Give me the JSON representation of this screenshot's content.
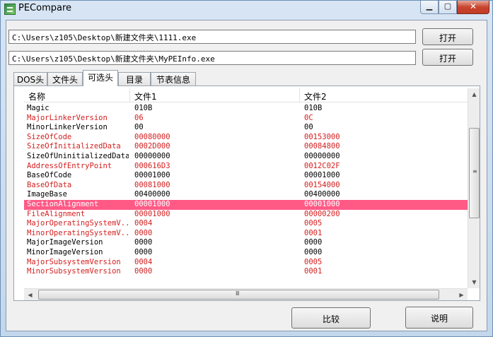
{
  "window": {
    "title": "PECompare"
  },
  "files": [
    {
      "path": "C:\\Users\\z105\\Desktop\\新建文件夹\\1111.exe",
      "open_label": "打开"
    },
    {
      "path": "C:\\Users\\z105\\Desktop\\新建文件夹\\MyPEInfo.exe",
      "open_label": "打开"
    }
  ],
  "tabs": [
    {
      "label": "DOS头"
    },
    {
      "label": "文件头"
    },
    {
      "label": "可选头",
      "active": true
    },
    {
      "label": "目录"
    },
    {
      "label": "节表信息"
    }
  ],
  "table": {
    "columns": [
      "名称",
      "文件1",
      "文件2"
    ],
    "rows": [
      {
        "name": "Magic",
        "file1": "010B",
        "file2": "010B",
        "status": "same"
      },
      {
        "name": "MajorLinkerVersion",
        "file1": "06",
        "file2": "0C",
        "status": "diff"
      },
      {
        "name": "MinorLinkerVersion",
        "file1": "00",
        "file2": "00",
        "status": "same"
      },
      {
        "name": "SizeOfCode",
        "file1": "00080000",
        "file2": "00153000",
        "status": "diff"
      },
      {
        "name": "SizeOfInitializedData",
        "file1": "0002D000",
        "file2": "00084800",
        "status": "diff"
      },
      {
        "name": "SizeOfUninitializedData",
        "file1": "00000000",
        "file2": "00000000",
        "status": "same"
      },
      {
        "name": "AddressOfEntryPoint",
        "file1": "000616D3",
        "file2": "0012C02F",
        "status": "diff"
      },
      {
        "name": "BaseOfCode",
        "file1": "00001000",
        "file2": "00001000",
        "status": "same"
      },
      {
        "name": "BaseOfData",
        "file1": "00081000",
        "file2": "00154000",
        "status": "diff"
      },
      {
        "name": "ImageBase",
        "file1": "00400000",
        "file2": "00400000",
        "status": "same"
      },
      {
        "name": "SectionAlignment",
        "file1": "00001000",
        "file2": "00001000",
        "status": "selected"
      },
      {
        "name": "FileAlignment",
        "file1": "00001000",
        "file2": "00000200",
        "status": "diff"
      },
      {
        "name": "MajorOperatingSystemV...",
        "file1": "0004",
        "file2": "0005",
        "status": "diff"
      },
      {
        "name": "MinorOperatingSystemV...",
        "file1": "0000",
        "file2": "0001",
        "status": "diff"
      },
      {
        "name": "MajorImageVersion",
        "file1": "0000",
        "file2": "0000",
        "status": "same"
      },
      {
        "name": "MinorImageVersion",
        "file1": "0000",
        "file2": "0000",
        "status": "same"
      },
      {
        "name": "MajorSubsystemVersion",
        "file1": "0004",
        "file2": "0005",
        "status": "diff"
      },
      {
        "name": "MinorSubsystemVersion",
        "file1": "0000",
        "file2": "0001",
        "status": "diff"
      }
    ]
  },
  "buttons": {
    "compare": "比较",
    "help": "说明"
  },
  "colors": {
    "diff_text": "#d41e1e",
    "selected_row": "#ff5a86"
  },
  "icons": {
    "app": "pecompare-app-icon",
    "minimize": "minimize-icon",
    "maximize": "maximize-icon",
    "close": "close-icon"
  }
}
